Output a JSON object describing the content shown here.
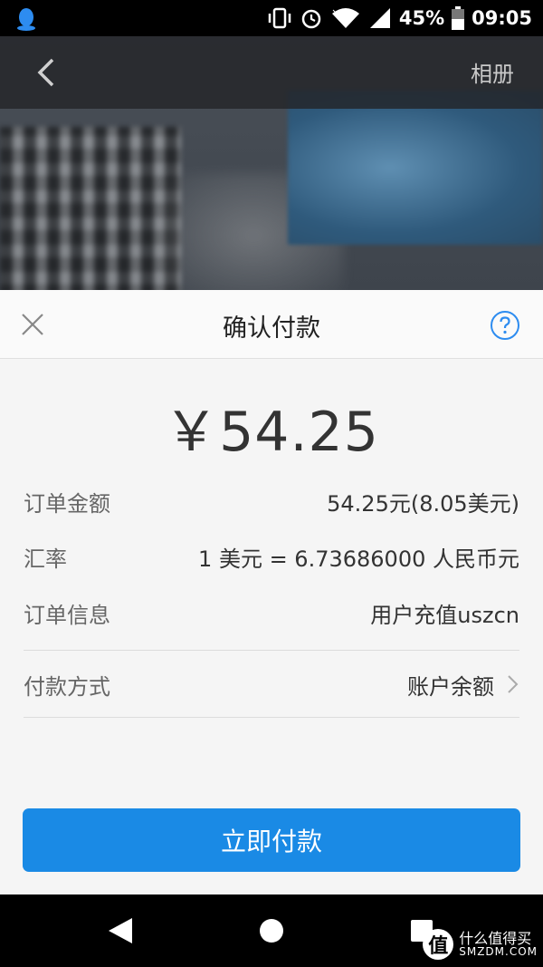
{
  "status_bar": {
    "battery_percent": "45%",
    "time": "09:05",
    "icons": [
      "qq-icon",
      "vibrate-icon",
      "alarm-icon",
      "wifi-icon",
      "signal-icon",
      "battery-icon"
    ]
  },
  "nav_bar": {
    "album_label": "相册"
  },
  "sheet": {
    "title": "确认付款",
    "amount": "￥54.25",
    "rows": [
      {
        "label": "订单金额",
        "value": "54.25元(8.05美元)"
      },
      {
        "label": "汇率",
        "value": "1 美元 = 6.73686000 人民币元"
      },
      {
        "label": "订单信息",
        "value": "用户充值uszcn"
      }
    ],
    "payment_method": {
      "label": "付款方式",
      "value": "账户余额"
    },
    "pay_button_label": "立即付款"
  },
  "watermark": {
    "logo_char": "值",
    "cn": "什么值得买",
    "en": "SMZDM.COM"
  },
  "colors": {
    "accent": "#1a8ae5",
    "sheet_bg": "#f5f5f5",
    "nav_overlay": "#232528"
  }
}
